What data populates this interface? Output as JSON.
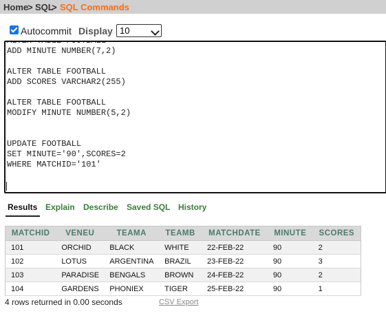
{
  "breadcrumb": {
    "home": "Home",
    "sep1": " > ",
    "sql": "SQL",
    "sep2": " > ",
    "current": "SQL Commands"
  },
  "toolbar": {
    "autocommit_label": "Autocommit",
    "autocommit_checked": true,
    "display_label": "Display",
    "display_value": "10"
  },
  "editor": {
    "lines": [
      "ALTER TABLE FOOTBALL",
      "ADD MINUTE NUMBER(7,2)",
      "",
      "ALTER TABLE FOOTBALL",
      "ADD SCORES VARCHAR2(255)",
      "",
      "ALTER TABLE FOOTBALL",
      "MODIFY MINUTE NUMBER(5,2)",
      "",
      "",
      "UPDATE FOOTBALL",
      "SET MINUTE='90',SCORES=2",
      "WHERE MATCHID='101'"
    ]
  },
  "tabs": [
    "Results",
    "Explain",
    "Describe",
    "Saved SQL",
    "History"
  ],
  "results": {
    "columns": [
      "MATCHID",
      "VENEU",
      "TEAMA",
      "TEAMB",
      "MATCHDATE",
      "MINUTE",
      "SCORES"
    ],
    "rows": [
      [
        "101",
        "ORCHID",
        "BLACK",
        "WHITE",
        "22-FEB-22",
        "90",
        "2"
      ],
      [
        "102",
        "LOTUS",
        "ARGENTINA",
        "BRAZIL",
        "23-FEB-22",
        "90",
        "3"
      ],
      [
        "103",
        "PARADISE",
        "BENGALS",
        "BROWN",
        "24-FEB-22",
        "90",
        "2"
      ],
      [
        "104",
        "GARDENS",
        "PHONIEX",
        "TIGER",
        "25-FEB-22",
        "90",
        "1"
      ]
    ]
  },
  "footer": {
    "count_text": "4 rows returned in 0.00 seconds",
    "csv_label": "CSV Export"
  },
  "colors": {
    "accent": "#ff6d12",
    "tab_link": "#3b7d3b",
    "header_text": "#4a7b6a"
  }
}
